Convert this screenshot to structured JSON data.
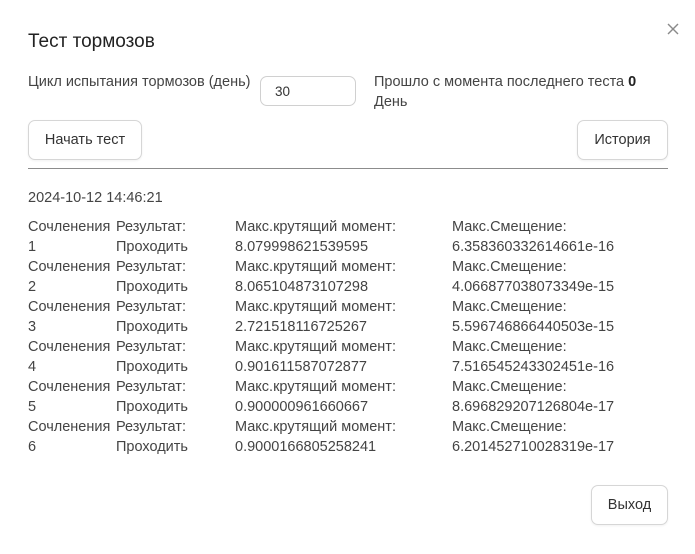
{
  "dialog": {
    "title": "Тест тормозов",
    "close_icon": "close-icon"
  },
  "settings": {
    "cycle_label": "Цикл испытания тормозов (день)",
    "cycle_value": "30",
    "elapsed_label": "Прошло с момента последнего теста",
    "elapsed_value": "0",
    "elapsed_unit": "День"
  },
  "buttons": {
    "start": "Начать тест",
    "history": "История",
    "exit": "Выход"
  },
  "test": {
    "timestamp": "2024-10-12 14:46:21",
    "joints": [
      {
        "joint_label": "Сочленения",
        "joint_num": "1",
        "result_label": "Результат:",
        "result_value": "Проходить",
        "torque_label": "Макс.крутящий момент:",
        "torque_value": "8.079998621539595",
        "offset_label": "Макс.Смещение:",
        "offset_value": "6.358360332614661e-16"
      },
      {
        "joint_label": "Сочленения",
        "joint_num": "2",
        "result_label": "Результат:",
        "result_value": "Проходить",
        "torque_label": "Макс.крутящий момент:",
        "torque_value": "8.065104873107298",
        "offset_label": "Макс.Смещение:",
        "offset_value": "4.066877038073349e-15"
      },
      {
        "joint_label": "Сочленения",
        "joint_num": "3",
        "result_label": "Результат:",
        "result_value": "Проходить",
        "torque_label": "Макс.крутящий момент:",
        "torque_value": "2.721518116725267",
        "offset_label": "Макс.Смещение:",
        "offset_value": "5.596746866440503e-15"
      },
      {
        "joint_label": "Сочленения",
        "joint_num": "4",
        "result_label": "Результат:",
        "result_value": "Проходить",
        "torque_label": "Макс.крутящий момент:",
        "torque_value": "0.901611587072877",
        "offset_label": "Макс.Смещение:",
        "offset_value": "7.516545243302451e-16"
      },
      {
        "joint_label": "Сочленения",
        "joint_num": "5",
        "result_label": "Результат:",
        "result_value": "Проходить",
        "torque_label": "Макс.крутящий момент:",
        "torque_value": "0.900000961660667",
        "offset_label": "Макс.Смещение:",
        "offset_value": "8.696829207126804e-17"
      },
      {
        "joint_label": "Сочленения",
        "joint_num": "6",
        "result_label": "Результат:",
        "result_value": "Проходить",
        "torque_label": "Макс.крутящий момент:",
        "torque_value": "0.9000166805258241",
        "offset_label": "Макс.Смещение:",
        "offset_value": "6.201452710028319e-17"
      }
    ]
  },
  "colors": {
    "text": "#444444",
    "border": "#d6d6d6",
    "divider": "#8c8c8c"
  }
}
